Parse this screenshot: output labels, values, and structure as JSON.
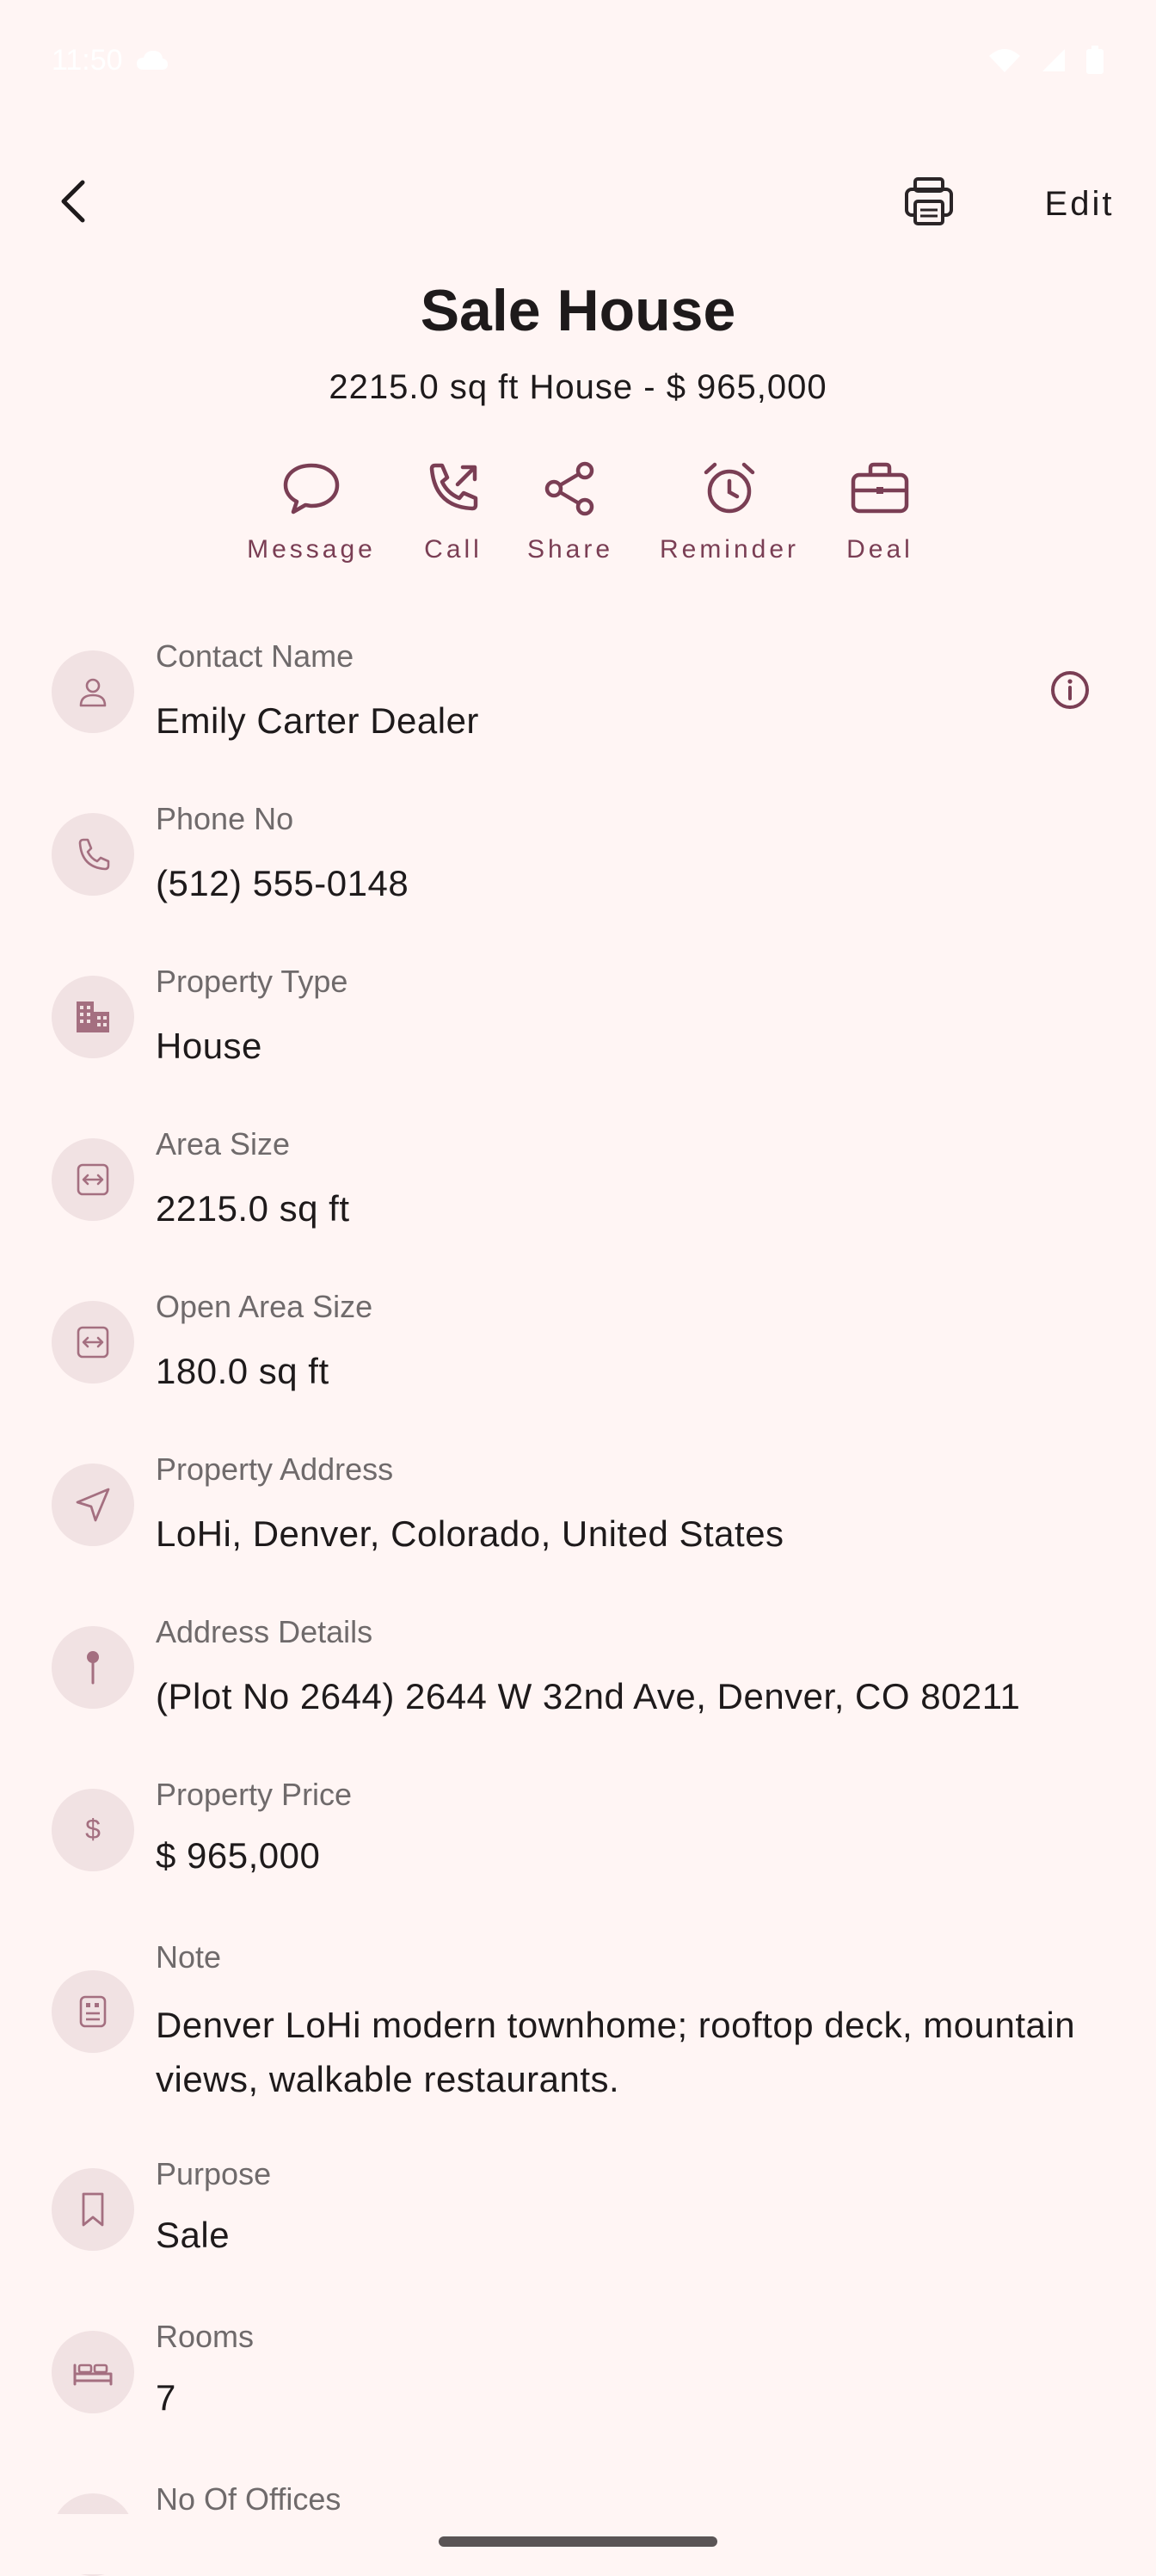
{
  "status_bar": {
    "time": "11:50"
  },
  "toolbar": {
    "edit_label": "Edit"
  },
  "header": {
    "title": "Sale House",
    "subtitle": "2215.0 sq ft House - $ 965,000"
  },
  "actions": [
    {
      "label": "Message",
      "icon": "message-bubble-icon"
    },
    {
      "label": "Call",
      "icon": "phone-outgoing-icon"
    },
    {
      "label": "Share",
      "icon": "share-icon"
    },
    {
      "label": "Reminder",
      "icon": "alarm-clock-icon"
    },
    {
      "label": "Deal",
      "icon": "briefcase-icon"
    }
  ],
  "details": [
    {
      "label": "Contact Name",
      "value": "Emily Carter Dealer",
      "icon": "person-icon"
    },
    {
      "label": "Phone No",
      "value": "(512) 555-0148",
      "icon": "phone-icon"
    },
    {
      "label": "Property Type",
      "value": "House",
      "icon": "building-icon"
    },
    {
      "label": "Area Size",
      "value": "2215.0 sq ft",
      "icon": "area-arrows-icon"
    },
    {
      "label": "Open Area Size",
      "value": "180.0 sq ft",
      "icon": "area-arrows-icon"
    },
    {
      "label": "Property Address",
      "value": "LoHi, Denver, Colorado, United States",
      "icon": "navigation-arrow-icon"
    },
    {
      "label": "Address Details",
      "value": "(Plot No 2644)   2644 W 32nd Ave, Denver, CO 80211",
      "icon": "pin-icon"
    },
    {
      "label": "Property Price",
      "value": "$ 965,000",
      "icon": "dollar-icon"
    },
    {
      "label": "Note",
      "value": "Denver LoHi modern townhome; rooftop deck, mountain views, walkable restaurants.",
      "icon": "note-icon"
    },
    {
      "label": "Purpose",
      "value": "Sale",
      "icon": "bookmark-icon"
    },
    {
      "label": "Rooms",
      "value": "7",
      "icon": "bed-icon"
    },
    {
      "label": "No Of Offices",
      "value": "",
      "icon": "office-icon"
    }
  ],
  "colors": {
    "background": "#fff5f4",
    "accent": "#7a3e54",
    "avatar_bg": "#f1e2e3",
    "icon_muted": "#a46f80"
  }
}
